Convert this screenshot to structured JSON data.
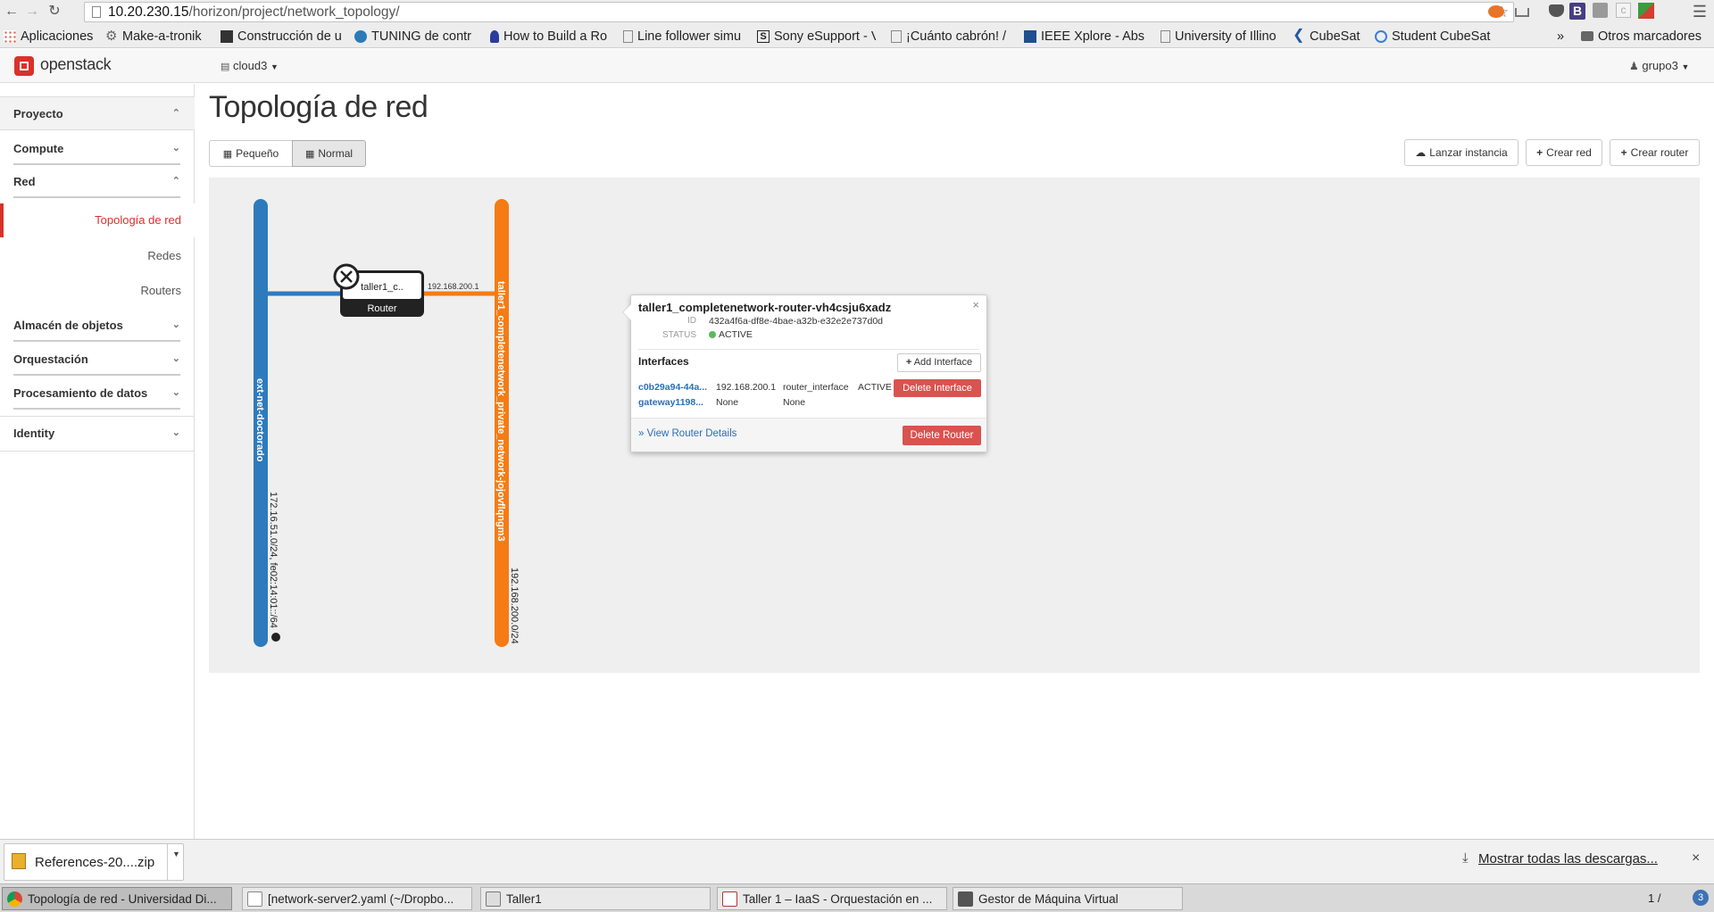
{
  "browser": {
    "url_host": "10.20.230.15",
    "url_path": "/horizon/project/network_topology/",
    "bookmarks": [
      {
        "label": "Aplicaciones",
        "icon": "apps-grid-icon"
      },
      {
        "label": "Make-a-tronik",
        "icon": "gear-icon"
      },
      {
        "label": "Construcción de u",
        "icon": "bookmark-favicon-icon"
      },
      {
        "label": "TUNING de contr",
        "icon": "wordpress-icon"
      },
      {
        "label": "How to Build a Ro",
        "icon": "robot-icon"
      },
      {
        "label": "Line follower simu",
        "icon": "page-icon"
      },
      {
        "label": "Sony eSupport - V",
        "icon": "sony-icon"
      },
      {
        "label": "¡Cuánto cabrón! /",
        "icon": "page-icon"
      },
      {
        "label": "IEEE Xplore - Abs",
        "icon": "ieee-icon"
      },
      {
        "label": "University of Illino",
        "icon": "page-icon"
      },
      {
        "label": "CubeSat",
        "icon": "cubesat-icon"
      },
      {
        "label": "Student CubeSat",
        "icon": "globe-icon"
      }
    ],
    "other_bookmarks": "Otros marcadores",
    "overflow": "»"
  },
  "header": {
    "logo_text": "openstack",
    "project_selector": "cloud3",
    "user_menu": "grupo3"
  },
  "sidebar": {
    "sections": [
      {
        "label": "Proyecto",
        "chevron": "up"
      },
      {
        "label": "Compute",
        "chevron": "down"
      },
      {
        "label": "Red",
        "chevron": "up"
      },
      {
        "label": "Almacén de objetos",
        "chevron": "down"
      },
      {
        "label": "Orquestación",
        "chevron": "down"
      },
      {
        "label": "Procesamiento de datos",
        "chevron": "down"
      },
      {
        "label": "Identity",
        "chevron": "down"
      }
    ],
    "red_items": [
      {
        "label": "Topología de red",
        "active": true
      },
      {
        "label": "Redes",
        "active": false
      },
      {
        "label": "Routers",
        "active": false
      }
    ]
  },
  "main": {
    "title": "Topología de red",
    "view_toggle": {
      "small": "Pequeño",
      "normal": "Normal",
      "selected": "normal"
    },
    "actions": {
      "launch_instance": "Lanzar instancia",
      "create_network": "Crear red",
      "create_router": "Crear router"
    }
  },
  "topology": {
    "ext_network": {
      "name": "ext-net-doctorado",
      "cidr": "172.16.51.0/24, fe02:14:01::/64",
      "color": "#2d7bbd"
    },
    "private_network": {
      "name": "taller1_completenetwork_private_network-jojovflqngm3",
      "cidr": "192.168.200.0/24",
      "color": "#f57c14"
    },
    "router": {
      "label": "taller1_c..",
      "type": "Router",
      "link_ip": "192.168.200.1"
    }
  },
  "popover": {
    "router_name": "taller1_completenetwork-router-vh4csju6xadz",
    "id_label": "ID",
    "id": "432a4f6a-df8e-4bae-a32b-e32e2e737d0d",
    "status_label": "STATUS",
    "status": "ACTIVE",
    "interfaces_title": "Interfaces",
    "add_interface": "Add Interface",
    "interfaces": [
      {
        "id": "c0b29a94-44a...",
        "ip": "192.168.200.1",
        "type": "router_interface",
        "status": "ACTIVE",
        "delete": "Delete Interface"
      },
      {
        "id": "gateway1198...",
        "ip": "None",
        "type": "None",
        "status": "",
        "delete": ""
      }
    ],
    "view_details": "» View Router Details",
    "delete_router": "Delete Router",
    "close": "×"
  },
  "downloads": {
    "item": "References-20....zip",
    "show_all": "Mostrar todas las descargas...",
    "close": "×"
  },
  "taskbar": {
    "tasks": [
      {
        "label": "Topología de red - Universidad Di...",
        "active": true
      },
      {
        "label": "[network-server2.yaml (~/Dropbo...",
        "active": false
      },
      {
        "label": "Taller1",
        "active": false
      },
      {
        "label": "Taller 1 – IaaS - Orquestación en ...",
        "active": false
      },
      {
        "label": "Gestor de Máquina Virtual",
        "active": false
      }
    ],
    "pager": "1 /  ",
    "notif_count": "3"
  }
}
